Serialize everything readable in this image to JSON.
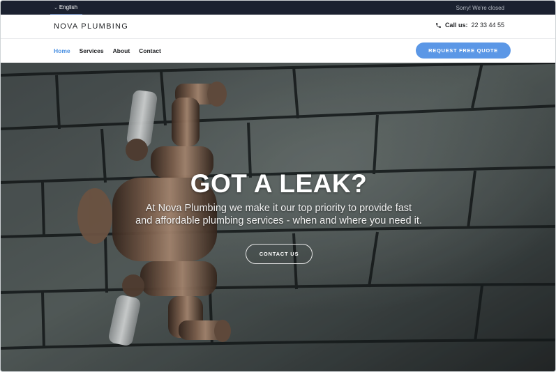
{
  "topbar": {
    "language": "English",
    "status": "Sorry! We're closed"
  },
  "header": {
    "logo": "NOVA PLUMBING",
    "call_label": "Call us:",
    "phone": "22 33 44 55"
  },
  "nav": {
    "items": [
      {
        "label": "Home",
        "active": true
      },
      {
        "label": "Services",
        "active": false
      },
      {
        "label": "About",
        "active": false
      },
      {
        "label": "Contact",
        "active": false
      }
    ],
    "quote_button": "REQUEST FREE QUOTE"
  },
  "hero": {
    "title": "GOT A LEAK?",
    "subtitle_line1": "At Nova Plumbing we make it our top priority to provide fast",
    "subtitle_line2": "and affordable plumbing services - when and where you need it.",
    "cta": "CONTACT US"
  },
  "colors": {
    "topbar_bg": "#1b2130",
    "accent": "#5b97e6",
    "active_link": "#4a90e2"
  }
}
